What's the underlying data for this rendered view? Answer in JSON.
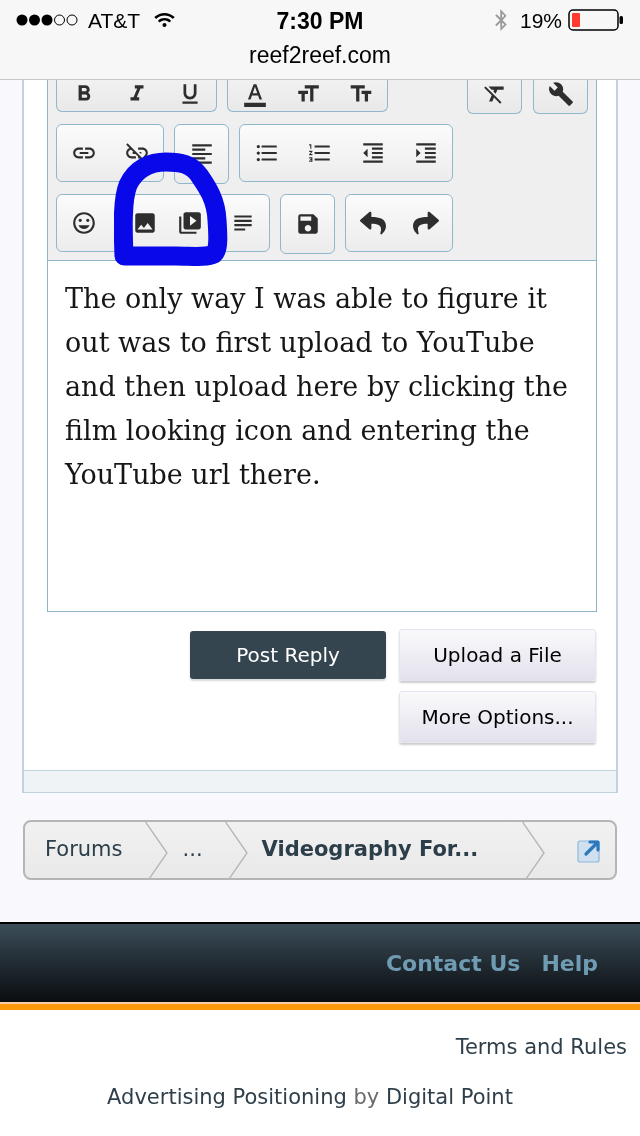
{
  "status_bar": {
    "carrier": "AT&T",
    "time": "7:30 PM",
    "battery": "19%",
    "url": "reef2reef.com"
  },
  "editor": {
    "text": "The only way I was able to figure it out was to first upload to YouTube and then upload here by clicking the film looking icon and entering the YouTube url there."
  },
  "actions": [
    {
      "label": "Post Reply",
      "kind": "primary"
    },
    {
      "label": "Upload a File",
      "kind": "secondary"
    },
    {
      "label": "More Options...",
      "kind": "secondary"
    }
  ],
  "breadcrumb": [
    {
      "label": "Forums",
      "current": false
    },
    {
      "label": "...",
      "current": false
    },
    {
      "label": "Videography For...",
      "current": true
    }
  ],
  "footer": {
    "links": [
      "Contact Us",
      "Help"
    ],
    "terms": "Terms and Rules",
    "credit": {
      "link": "Advertising Positioning",
      "joiner": "by",
      "company": "Digital Point"
    }
  }
}
